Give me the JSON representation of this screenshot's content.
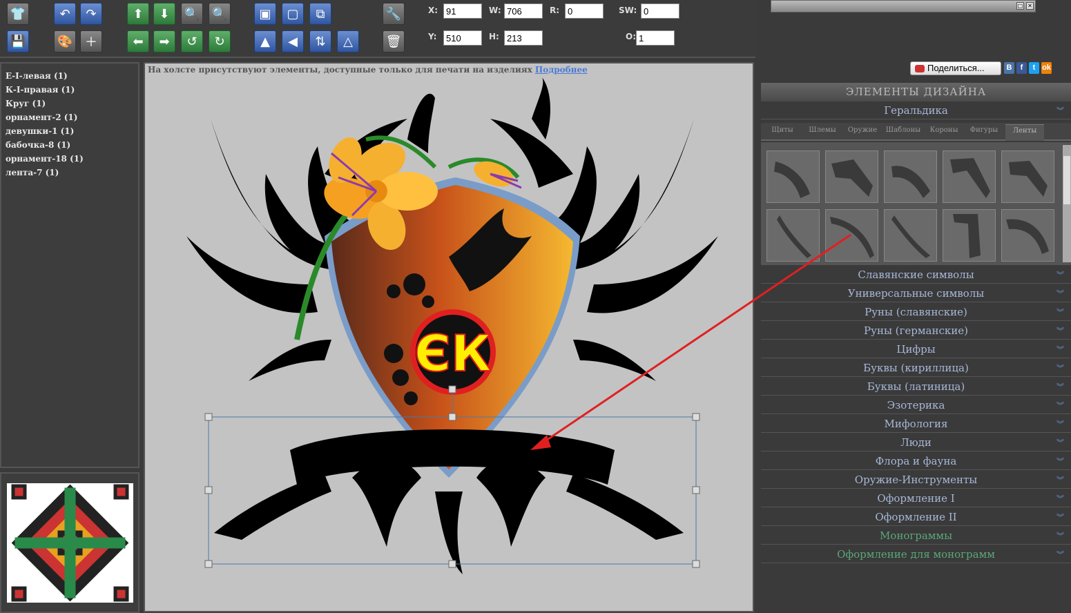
{
  "toolbar": {
    "tools": [
      "shirt-icon",
      "undo-icon",
      "redo-icon",
      "arrow-up-icon",
      "arrow-down-icon",
      "zoom-in-icon",
      "zoom-out-icon",
      "bring-front-icon",
      "send-back-icon",
      "layers-icon",
      "wrench-icon",
      "save-icon",
      "palette-icon",
      "add-image-icon",
      "arrow-left-icon",
      "arrow-right-icon",
      "rotate-left-icon",
      "rotate-right-icon",
      "flip-vertical-icon",
      "flip-horizontal-icon",
      "flip-icon",
      "distort-icon",
      "trash-icon"
    ],
    "fields": {
      "x_label": "X:",
      "x_value": "91",
      "w_label": "W:",
      "w_value": "706",
      "r_label": "R:",
      "r_value": "0",
      "sw_label": "SW:",
      "sw_value": "0",
      "y_label": "Y:",
      "y_value": "510",
      "h_label": "H:",
      "h_value": "213",
      "o_label": "O:",
      "o_value": "1"
    }
  },
  "layers": [
    "Е-I-левая (1)",
    "К-I-правая (1)",
    "Круг (1)",
    "орнамент-2 (1)",
    "девушки-1 (1)",
    "бабочка-8 (1)",
    "орнамент-18 (1)",
    "лента-7 (1)"
  ],
  "canvas": {
    "notice": "На холсте присутствуют элементы, доступные только для печати на изделиях ",
    "notice_link": "Подробнее",
    "monogram": "ЄК"
  },
  "share": {
    "label": "Поделиться...",
    "icons": [
      "vk-icon",
      "facebook-icon",
      "twitter-icon",
      "odnoklassniki-icon"
    ]
  },
  "panel": {
    "title": "ЭЛЕМЕНТЫ ДИЗАЙНА",
    "open_category": "Геральдика",
    "tabs": [
      "Щиты",
      "Шлемы",
      "Оружие",
      "Шаблоны",
      "Короны",
      "Фигуры",
      "Ленты"
    ],
    "active_tab": "Ленты",
    "categories": [
      "Славянские символы",
      "Универсальные символы",
      "Руны (славянские)",
      "Руны (германские)",
      "Цифры",
      "Буквы (кириллица)",
      "Буквы (латиница)",
      "Эзотерика",
      "Мифология",
      "Люди",
      "Флора и фауна",
      "Оружие-Инструменты",
      "Оформление I",
      "Оформление II",
      "Монограммы",
      "Оформление для монограмм"
    ]
  },
  "colors": {
    "accent": "#6f95d8",
    "arrow": "#e02020",
    "shield_dark": "#5a2a1a",
    "shield_light": "#f5b830",
    "monogram_fill": "#ffee00",
    "monogram_ring": "#e02020"
  }
}
